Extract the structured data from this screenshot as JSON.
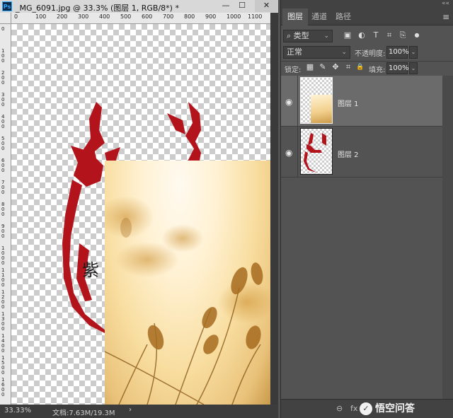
{
  "document": {
    "app_badge": "Ps",
    "title": "_MG_6091.jpg @ 33.3% (图层 1, RGB/8*) *",
    "window_controls": {
      "minimize": "—",
      "maximize": "☐",
      "close": "✕"
    },
    "ruler_top_ticks": [
      "0",
      "100",
      "200",
      "300",
      "400",
      "500",
      "600",
      "700",
      "800",
      "900",
      "1000",
      "1100"
    ],
    "ruler_left_ticks": [
      "0",
      "100",
      "200",
      "300",
      "400",
      "500",
      "600",
      "700",
      "800",
      "900",
      "1000",
      "1100",
      "1200",
      "1300",
      "1400",
      "1500",
      "1600"
    ],
    "canvas_character": "紫",
    "status_zoom": "33.33%",
    "status_doc": "文档:7.63M/19.3M",
    "status_arrow": "›"
  },
  "panel": {
    "collapse": "««",
    "tabs": [
      {
        "label": "图层",
        "active": true
      },
      {
        "label": "通道",
        "active": false
      },
      {
        "label": "路径",
        "active": false
      }
    ],
    "menu_icon": "≡",
    "filter": {
      "icon": "⌕",
      "label": "类型",
      "arrow": "⌄"
    },
    "filter_icons": [
      {
        "name": "image-filter-icon",
        "glyph": "▣"
      },
      {
        "name": "adjustment-filter-icon",
        "glyph": "◐"
      },
      {
        "name": "type-filter-icon",
        "glyph": "T"
      },
      {
        "name": "shape-filter-icon",
        "glyph": "⌗"
      },
      {
        "name": "smart-object-filter-icon",
        "glyph": "⎘"
      },
      {
        "name": "filter-toggle-icon",
        "glyph": "●"
      }
    ],
    "blend_mode": "正常",
    "blend_arrow": "⌄",
    "opacity_label": "不透明度:",
    "opacity_value": "100%",
    "opacity_arrow": "⌄",
    "lock_label": "锁定:",
    "lock_icons": [
      {
        "name": "lock-transparent-icon",
        "glyph": "▦"
      },
      {
        "name": "lock-paint-icon",
        "glyph": "✎"
      },
      {
        "name": "lock-move-icon",
        "glyph": "✥"
      },
      {
        "name": "lock-artboard-icon",
        "glyph": "⌗"
      },
      {
        "name": "lock-all-icon",
        "glyph": "🔒"
      }
    ],
    "fill_label": "填充:",
    "fill_value": "100%",
    "fill_arrow": "⌄",
    "layers": [
      {
        "name": "图层 1",
        "selected": true,
        "visible_glyph": "◉"
      },
      {
        "name": "图层 2",
        "selected": false,
        "visible_glyph": "◉"
      }
    ],
    "bottom_icons": [
      {
        "name": "link-layers-icon",
        "glyph": "⊖"
      },
      {
        "name": "fx-icon",
        "glyph": "fx"
      }
    ],
    "watermark": {
      "logo": "✓",
      "text": "悟空问答"
    }
  },
  "colors": {
    "ink_red": "#b3141c",
    "panel_bg": "#535353",
    "selected_row": "#6b6b6b"
  }
}
